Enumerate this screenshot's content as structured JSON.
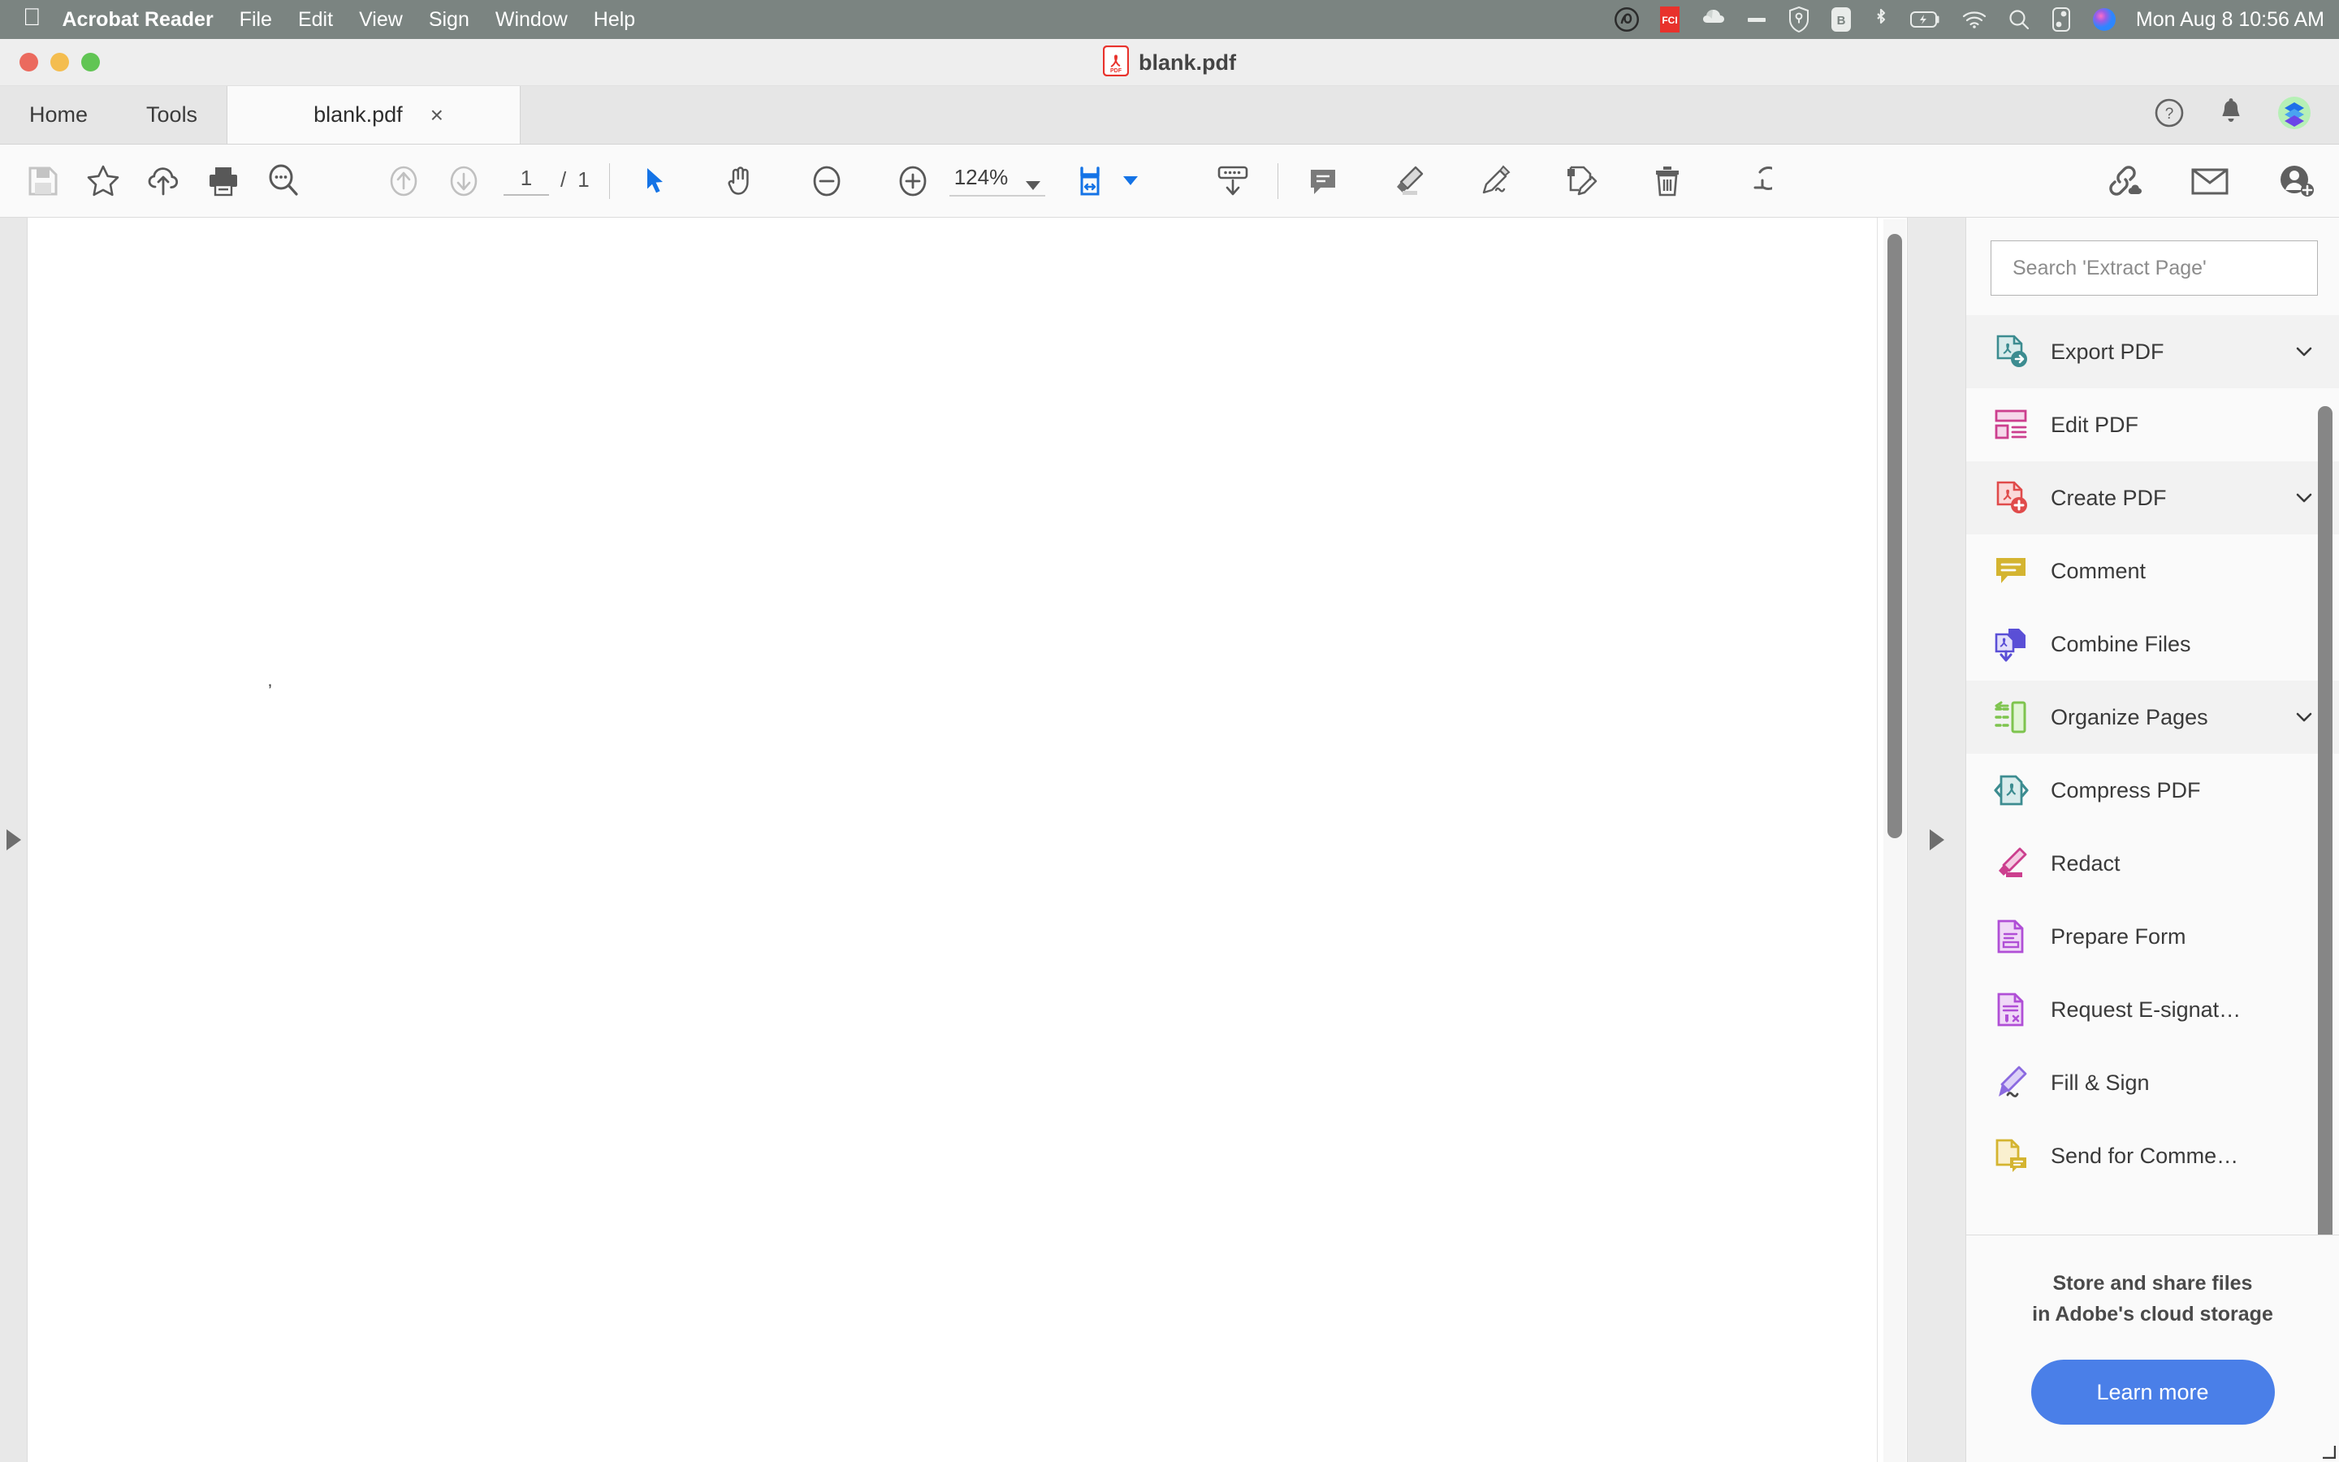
{
  "menubar": {
    "apple_icon": "apple-logo-icon",
    "app_name": "Acrobat Reader",
    "items": [
      "File",
      "Edit",
      "View",
      "Sign",
      "Window",
      "Help"
    ],
    "status_icons": [
      "creative-cloud-icon",
      "fci-badge-icon",
      "dropbox-cloud-icon",
      "minus-icon",
      "shield-link-icon",
      "bo-app-icon",
      "bluetooth-icon",
      "battery-charging-icon",
      "wifi-icon",
      "spotlight-search-icon",
      "control-center-icon",
      "siri-icon"
    ],
    "clock": "Mon Aug 8  10:56 AM"
  },
  "window": {
    "title": "blank.pdf",
    "doc_icon": "pdf-file-icon",
    "traffic_lights": [
      "close",
      "minimize",
      "maximize"
    ]
  },
  "tabbar": {
    "home_label": "Home",
    "tools_label": "Tools",
    "doc_tab_label": "blank.pdf",
    "close_label": "×",
    "actions": [
      "help-circle-icon",
      "bell-icon",
      "avatar"
    ]
  },
  "toolbar": {
    "left_icons": [
      "save-icon",
      "star-icon",
      "cloud-upload-icon",
      "print-icon",
      "search-icon"
    ],
    "nav_icons": [
      "page-up-icon",
      "page-down-icon"
    ],
    "page_current": "1",
    "page_separator": "/",
    "page_total": "1",
    "tools": [
      "select-tool-icon",
      "hand-tool-icon",
      "zoom-out-icon",
      "zoom-in-icon"
    ],
    "zoom_value": "124%",
    "fit_icon": "fit-page-icon",
    "scroll_icon": "scroll-mode-icon",
    "annot_icons": [
      "comment-icon",
      "highlighter-icon",
      "sign-pen-icon",
      "fill-sign-icon",
      "delete-icon",
      "rotate-icon"
    ],
    "share_icons": [
      "share-link-icon",
      "email-icon",
      "add-person-icon"
    ],
    "accent_color": "#1473e6"
  },
  "document": {
    "page_mark": "’",
    "rail_expand_icon": "chevron-right-triangle-icon"
  },
  "sidebar": {
    "search_placeholder": "Search 'Extract Page'",
    "tools": [
      {
        "label": "Export PDF",
        "icon": "export-pdf-icon",
        "color": "#3c8c90",
        "chevron": true,
        "highlight": true
      },
      {
        "label": "Edit PDF",
        "icon": "edit-pdf-icon",
        "color": "#cc3f8e",
        "chevron": false,
        "highlight": false
      },
      {
        "label": "Create PDF",
        "icon": "create-pdf-icon",
        "color": "#e04b4b",
        "chevron": true,
        "highlight": true
      },
      {
        "label": "Comment",
        "icon": "comment-icon",
        "color": "#d4b430",
        "chevron": false,
        "highlight": false
      },
      {
        "label": "Combine Files",
        "icon": "combine-files-icon",
        "color": "#5a4fd6",
        "chevron": false,
        "highlight": false
      },
      {
        "label": "Organize Pages",
        "icon": "organize-pages-icon",
        "color": "#7ec44e",
        "chevron": true,
        "highlight": true
      },
      {
        "label": "Compress PDF",
        "icon": "compress-pdf-icon",
        "color": "#3c8c90",
        "chevron": false,
        "highlight": false
      },
      {
        "label": "Redact",
        "icon": "redact-icon",
        "color": "#cc3f8e",
        "chevron": false,
        "highlight": false
      },
      {
        "label": "Prepare Form",
        "icon": "prepare-form-icon",
        "color": "#b04fd6",
        "chevron": false,
        "highlight": false
      },
      {
        "label": "Request E-signat…",
        "icon": "request-esign-icon",
        "color": "#b04fd6",
        "chevron": false,
        "highlight": false
      },
      {
        "label": "Fill & Sign",
        "icon": "fill-sign-icon",
        "color": "#8b6ae0",
        "chevron": false,
        "highlight": false
      },
      {
        "label": "Send for Comme…",
        "icon": "send-for-comments-icon",
        "color": "#d4b430",
        "chevron": false,
        "highlight": false
      }
    ],
    "promo_line1": "Store and share files",
    "promo_line2": "in Adobe's cloud storage",
    "learn_more_label": "Learn more",
    "learn_more_color": "#4a7fe8"
  }
}
